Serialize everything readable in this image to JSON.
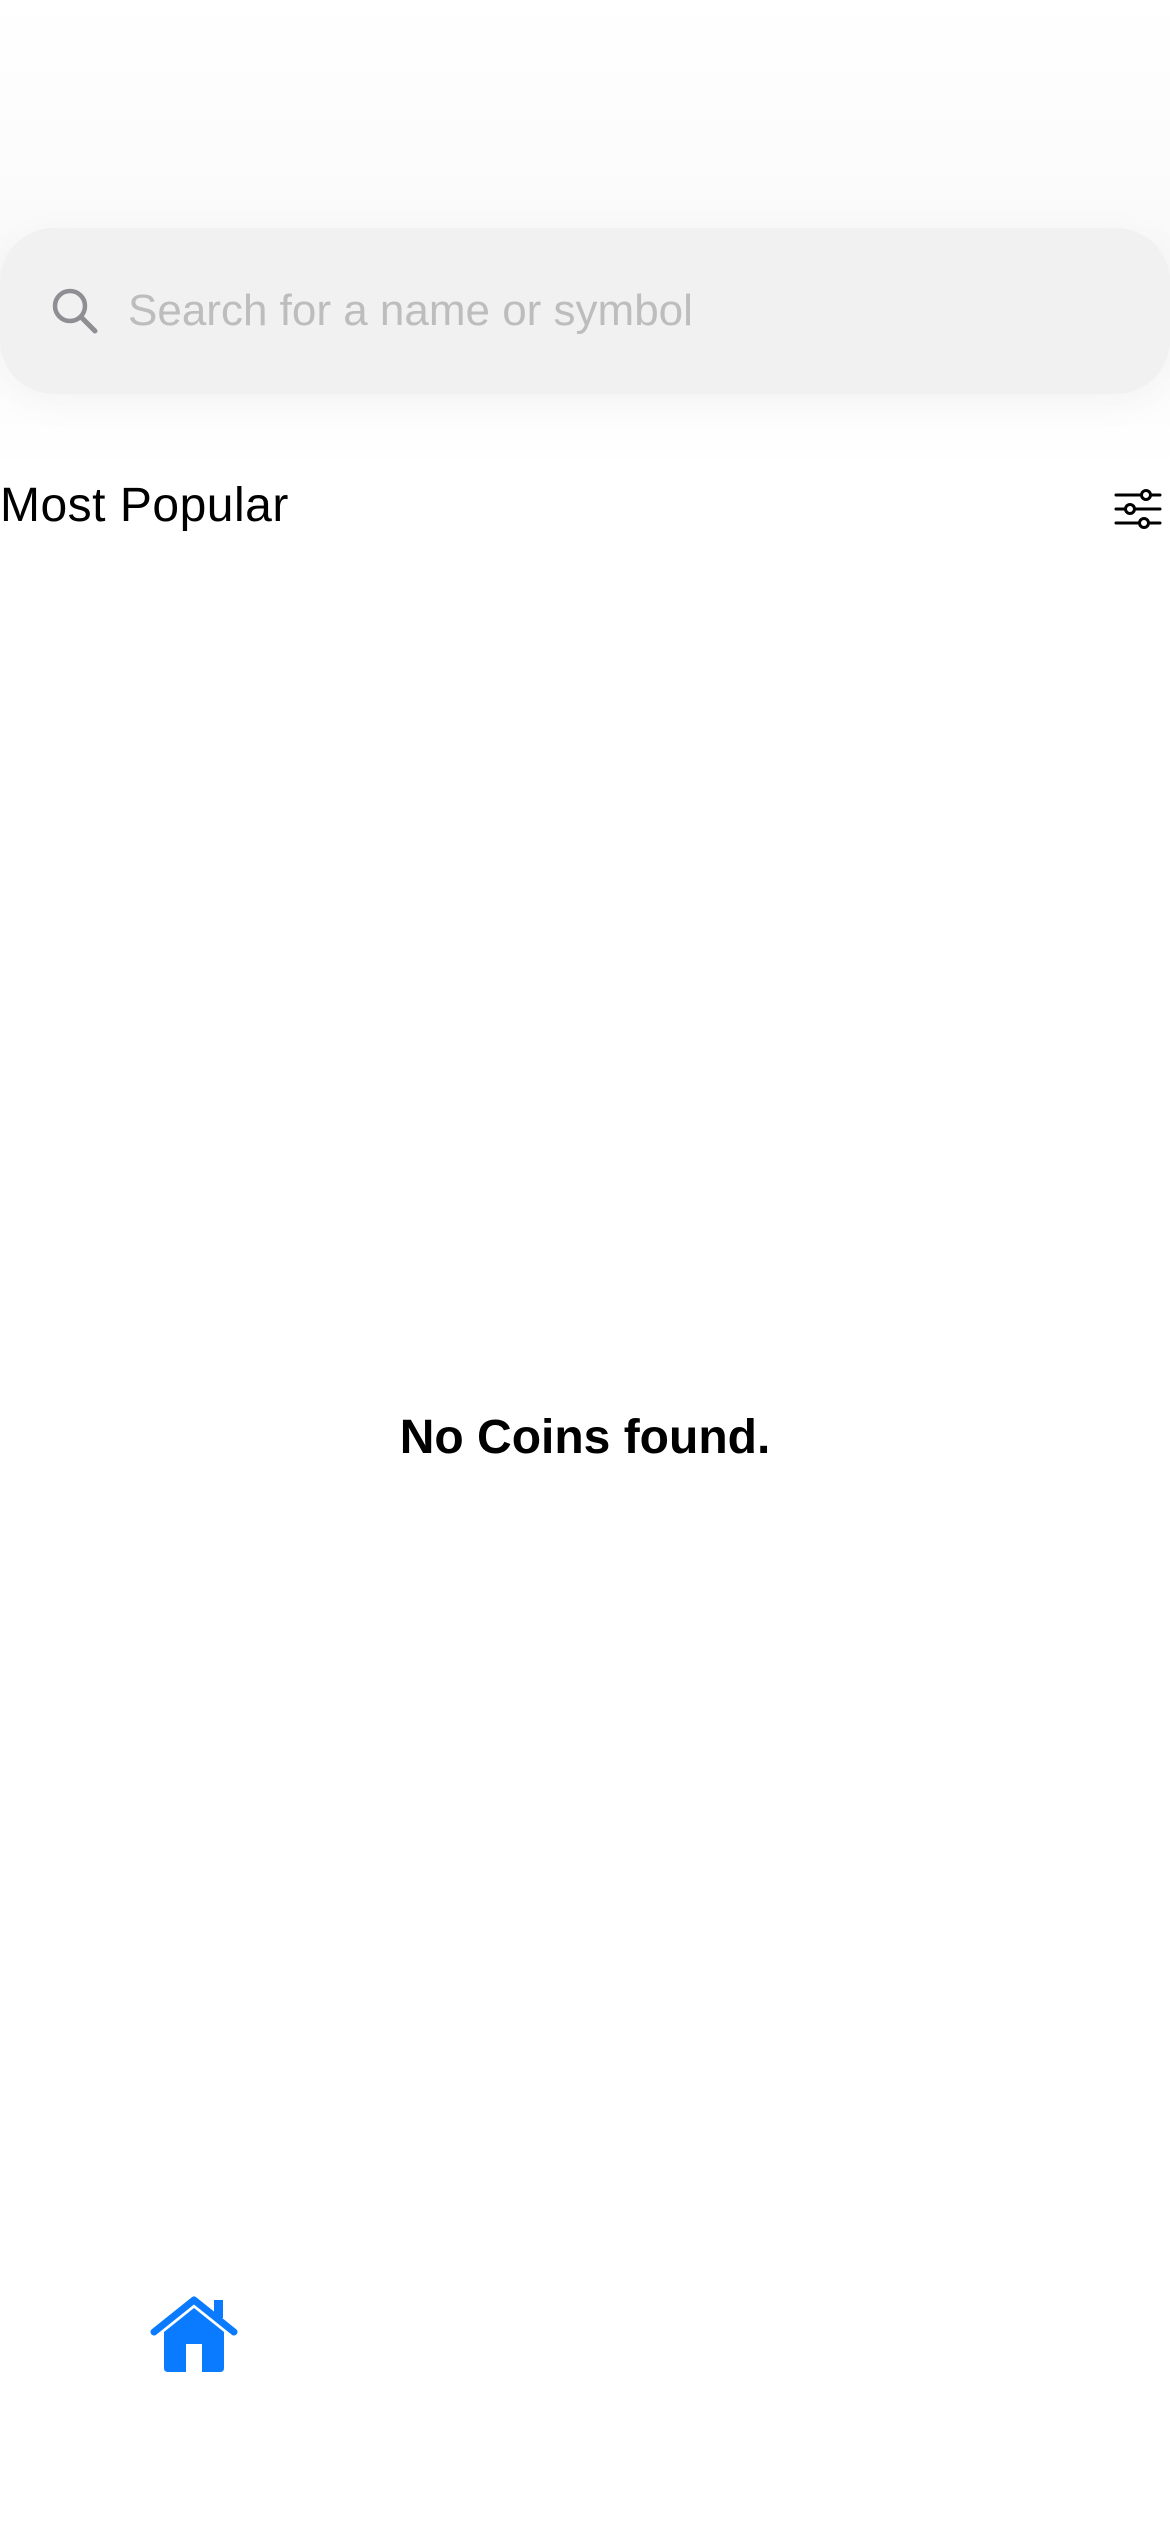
{
  "search": {
    "placeholder": "Search for a name or symbol",
    "icon": "search-icon"
  },
  "section": {
    "title": "Most Popular",
    "filter_icon": "sliders-icon"
  },
  "empty_state": {
    "message": "No Coins found."
  },
  "tab_bar": {
    "active_tab": "home",
    "home_icon": "home-icon"
  },
  "colors": {
    "accent": "#0a7aff",
    "search_bg": "#f1f1f1",
    "placeholder": "#bdbdbd"
  }
}
